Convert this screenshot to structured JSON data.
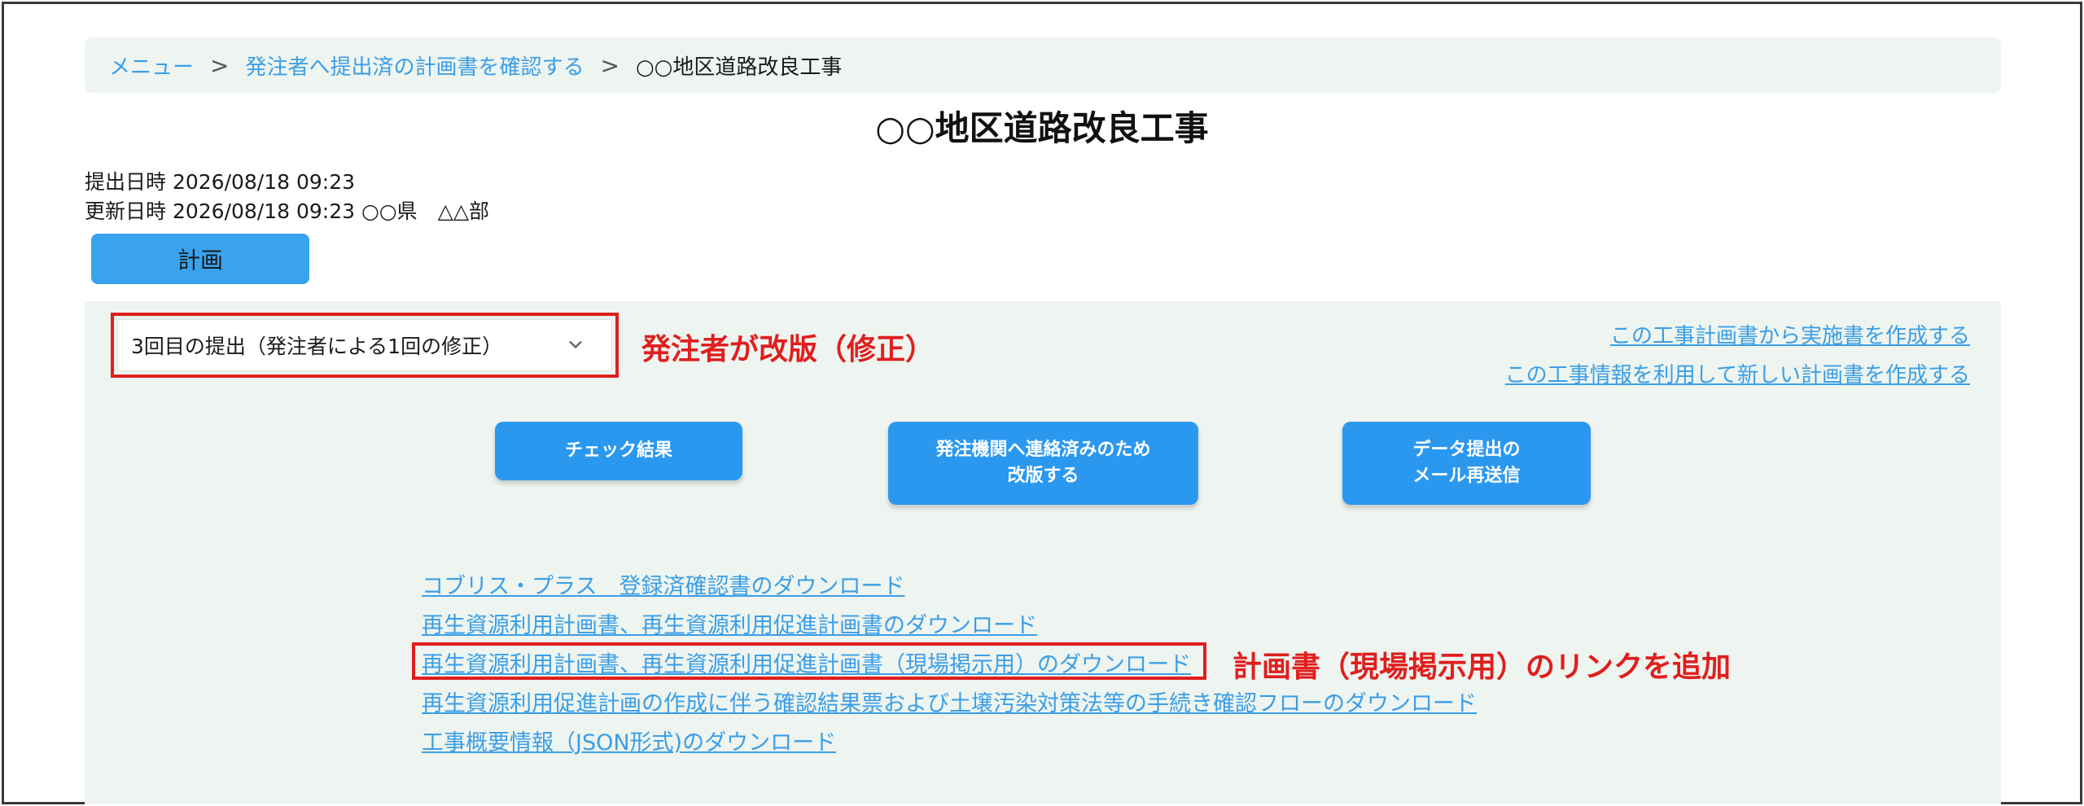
{
  "breadcrumb": {
    "items": [
      "メニュー",
      "発注者へ提出済の計画書を確認する"
    ],
    "separator": ">",
    "current": "○○地区道路改良工事"
  },
  "page": {
    "title": "○○地区道路改良工事",
    "submitted": "提出日時 2026/08/18 09:23",
    "updated": "更新日時 2026/08/18 09:23 ○○県　△△部"
  },
  "tabs": {
    "plan_label": "計画"
  },
  "version_select": {
    "selected": "3回目の提出（発注者による1回の修正）"
  },
  "annotations": {
    "revision_note": "発注者が改版（修正）",
    "link_added_note": "計画書（現場掲示用）のリンクを追加"
  },
  "right_links": {
    "create_implementation": "この工事計画書から実施書を作成する",
    "create_new_plan": "この工事情報を利用して新しい計画書を作成する"
  },
  "actions": {
    "check_results": "チェック結果",
    "revise": "発注機関へ連絡済みのため\n改版する",
    "resend_mail": "データ提出の\nメール再送信"
  },
  "downloads": [
    "コブリス・プラス　登録済確認書のダウンロード",
    "再生資源利用計画書、再生資源利用促進計画書のダウンロード",
    "再生資源利用計画書、再生資源利用促進計画書（現場掲示用）のダウンロード",
    "再生資源利用促進計画の作成に伴う確認結果票および土壌汚染対策法等の手続き確認フローのダウンロード",
    "工事概要情報（JSON形式)のダウンロード"
  ],
  "colors": {
    "accent": "#2b98f0",
    "link": "#3b9ee8",
    "annotation": "#e01e1e",
    "panel_bg": "#eef4ef"
  }
}
